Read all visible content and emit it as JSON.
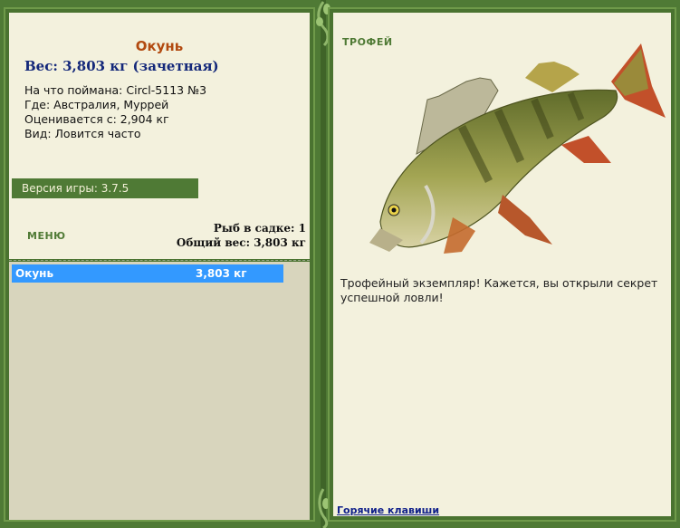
{
  "fish": {
    "name": "Окунь",
    "weight_line": "Вес: 3,803 кг (зачетная)",
    "bait_line": "На что поймана: Circl-5113 №3",
    "location_line": "Где: Австралия, Муррей",
    "valued_line": "Оценивается с: 2,904 кг",
    "type_line": "Вид: Ловится часто"
  },
  "version": "Версия игры: 3.7.5",
  "menu_label": "МЕНЮ",
  "keepnet": {
    "count_line": "Рыб в садке: 1",
    "total_line": "Общий вес: 3,803 кг",
    "items": [
      {
        "name": "Окунь",
        "weight": "3,803 кг"
      }
    ]
  },
  "trophy": {
    "label": "ТРОФЕЙ",
    "text": "Трофейный экземпляр! Кажется, вы открыли секрет успешной ловли!"
  },
  "hotkeys_link": "Горячие клавиши",
  "colors": {
    "frame_green": "#4f7a35",
    "panel_bg": "#f3f1dd",
    "selection_blue": "#3399ff",
    "fish_name": "#b24a10",
    "weight_text": "#14287a"
  },
  "icons": [
    "vine-ornament",
    "perch-fish-image"
  ]
}
